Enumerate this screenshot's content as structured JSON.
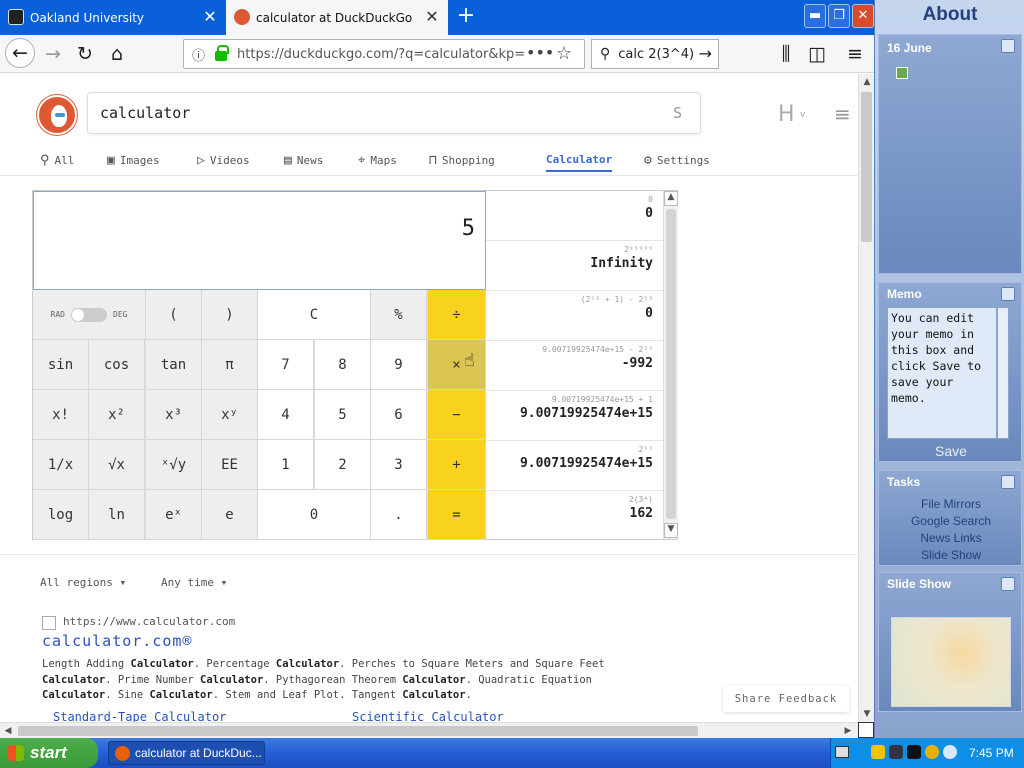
{
  "browser": {
    "tabs": [
      {
        "title": "Oakland University"
      },
      {
        "title": "calculator at DuckDuckGo"
      }
    ],
    "new_tab": "+",
    "window_controls": {
      "minimize": "▬",
      "maximize": "❐",
      "close": "✕"
    },
    "url": "https://duckduckgo.com/?q=calculator&kp=",
    "page_actions": "•••",
    "search_bar_text": "calc 2(3^4)"
  },
  "ddg": {
    "query": "calculator",
    "search_submit": "S",
    "h_icon": "H",
    "tabs": {
      "all": "All",
      "images": "Images",
      "videos": "Videos",
      "news": "News",
      "maps": "Maps",
      "shopping": "Shopping",
      "calculator": "Calculator",
      "settings": "Settings"
    }
  },
  "calculator": {
    "display": "5",
    "mode_left": "RAD",
    "mode_right": "DEG",
    "keys": {
      "lparen": "(",
      "rparen": ")",
      "clear": "C",
      "percent": "%",
      "divide": "÷",
      "sin": "sin",
      "cos": "cos",
      "tan": "tan",
      "pi": "π",
      "seven": "7",
      "eight": "8",
      "nine": "9",
      "multiply": "×",
      "fact": "x!",
      "square": "x²",
      "cube": "x³",
      "pow": "xʸ",
      "four": "4",
      "five": "5",
      "six": "6",
      "minus": "−",
      "recip": "1/x",
      "sqrt": "√x",
      "root": "ˣ√y",
      "ee": "EE",
      "one": "1",
      "two": "2",
      "three": "3",
      "plus": "+",
      "log": "log",
      "ln": "ln",
      "exp": "eˣ",
      "e": "e",
      "zero": "0",
      "dot": ".",
      "equals": "="
    },
    "history": [
      {
        "expression": "0",
        "result": "0"
      },
      {
        "expression": "2⁹⁹⁹⁹⁹",
        "result": "Infinity"
      },
      {
        "expression": "(2⁵³ + 1) - 2⁵³",
        "result": "0"
      },
      {
        "expression": "9.00719925474e+15 - 2⁵³",
        "result": "-992"
      },
      {
        "expression": "9.00719925474e+15 + 1",
        "result": "9.00719925474e+15"
      },
      {
        "expression": "2⁵³",
        "result": "9.00719925474e+15"
      },
      {
        "expression": "2(3⁴)",
        "result": "162"
      }
    ]
  },
  "filters": {
    "regions": "All regions ▾",
    "time": "Any time ▾"
  },
  "result": {
    "url": "https://www.calculator.com",
    "title": "calculator.com®",
    "snippet_line1_parts": [
      "Length Adding ",
      "Calculator",
      ". Percentage ",
      "Calculator",
      ". Perches to Square Meters and Square Feet"
    ],
    "snippet_line2_parts": [
      "Calculator",
      ". Prime Number ",
      "Calculator",
      ". Pythagorean Theorem ",
      "Calculator",
      ". Quadratic Equation"
    ],
    "snippet_line3_parts": [
      "Calculator",
      ". Sine ",
      "Calculator",
      ". Stem and Leaf Plot. Tangent ",
      "Calculator",
      "."
    ],
    "sitelinks": [
      "Standard-Tape Calculator",
      "Scientific Calculator"
    ]
  },
  "share_feedback": "Share Feedback",
  "sidebar": {
    "title": "About",
    "date": "16 June",
    "memo_title": "Memo",
    "memo_text": "You can edit your memo in this box and click Save to save your memo.",
    "save": "Save",
    "tasks_title": "Tasks",
    "tasks": [
      "File Mirrors",
      "Google Search",
      "News Links",
      "Slide Show"
    ],
    "slideshow_title": "Slide Show"
  },
  "taskbar": {
    "start": "start",
    "window": "calculator at DuckDuc...",
    "clock": "7:45 PM"
  }
}
